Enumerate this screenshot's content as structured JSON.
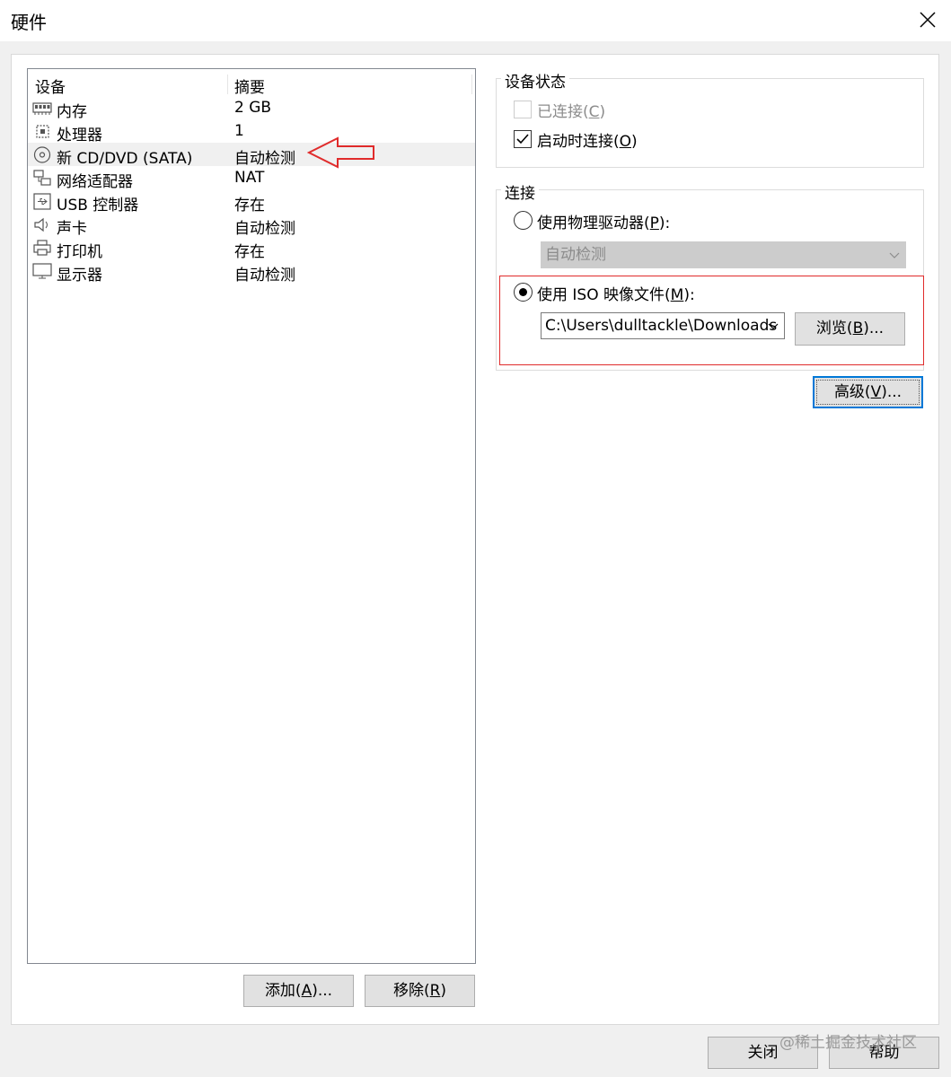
{
  "window": {
    "title": "硬件"
  },
  "device_list": {
    "columns": {
      "device": "设备",
      "summary": "摘要"
    },
    "rows": [
      {
        "name": "内存",
        "summary": "2 GB",
        "icon": "memory-icon"
      },
      {
        "name": "处理器",
        "summary": "1",
        "icon": "cpu-icon"
      },
      {
        "name": "新 CD/DVD (SATA)",
        "summary": "自动检测",
        "icon": "cd-dvd-icon"
      },
      {
        "name": "网络适配器",
        "summary": "NAT",
        "icon": "network-adapter-icon"
      },
      {
        "name": "USB 控制器",
        "summary": "存在",
        "icon": "usb-icon"
      },
      {
        "name": "声卡",
        "summary": "自动检测",
        "icon": "speaker-icon"
      },
      {
        "name": "打印机",
        "summary": "存在",
        "icon": "printer-icon"
      },
      {
        "name": "显示器",
        "summary": "自动检测",
        "icon": "monitor-icon"
      }
    ],
    "selected_index": 2
  },
  "buttons": {
    "add": {
      "text": "添加(",
      "key": "A",
      "suffix": ")..."
    },
    "remove": {
      "text": "移除(",
      "key": "R",
      "suffix": ")"
    },
    "browse": {
      "text": "浏览(",
      "key": "B",
      "suffix": ")..."
    },
    "advanced": {
      "text": "高级(",
      "key": "V",
      "suffix": ")..."
    },
    "close": "关闭",
    "help": "帮助"
  },
  "device_status": {
    "title": "设备状态",
    "connected": {
      "text": "已连接(",
      "key": "C",
      "suffix": ")",
      "checked": false,
      "enabled": false
    },
    "connect_at_power_on": {
      "text": "启动时连接(",
      "key": "O",
      "suffix": ")",
      "checked": true,
      "enabled": true
    }
  },
  "connection": {
    "title": "连接",
    "physical": {
      "text": "使用物理驱动器(",
      "key": "P",
      "suffix": "):",
      "selected": false,
      "value": "自动检测"
    },
    "iso": {
      "text": "使用 ISO 映像文件(",
      "key": "M",
      "suffix": "):",
      "selected": true,
      "value": "C:\\Users\\dulltackle\\Downloads"
    }
  },
  "watermark": "@稀土掘金技术社区",
  "colors": {
    "highlight_red": "#e02b2b",
    "focus_blue": "#0078d7"
  }
}
